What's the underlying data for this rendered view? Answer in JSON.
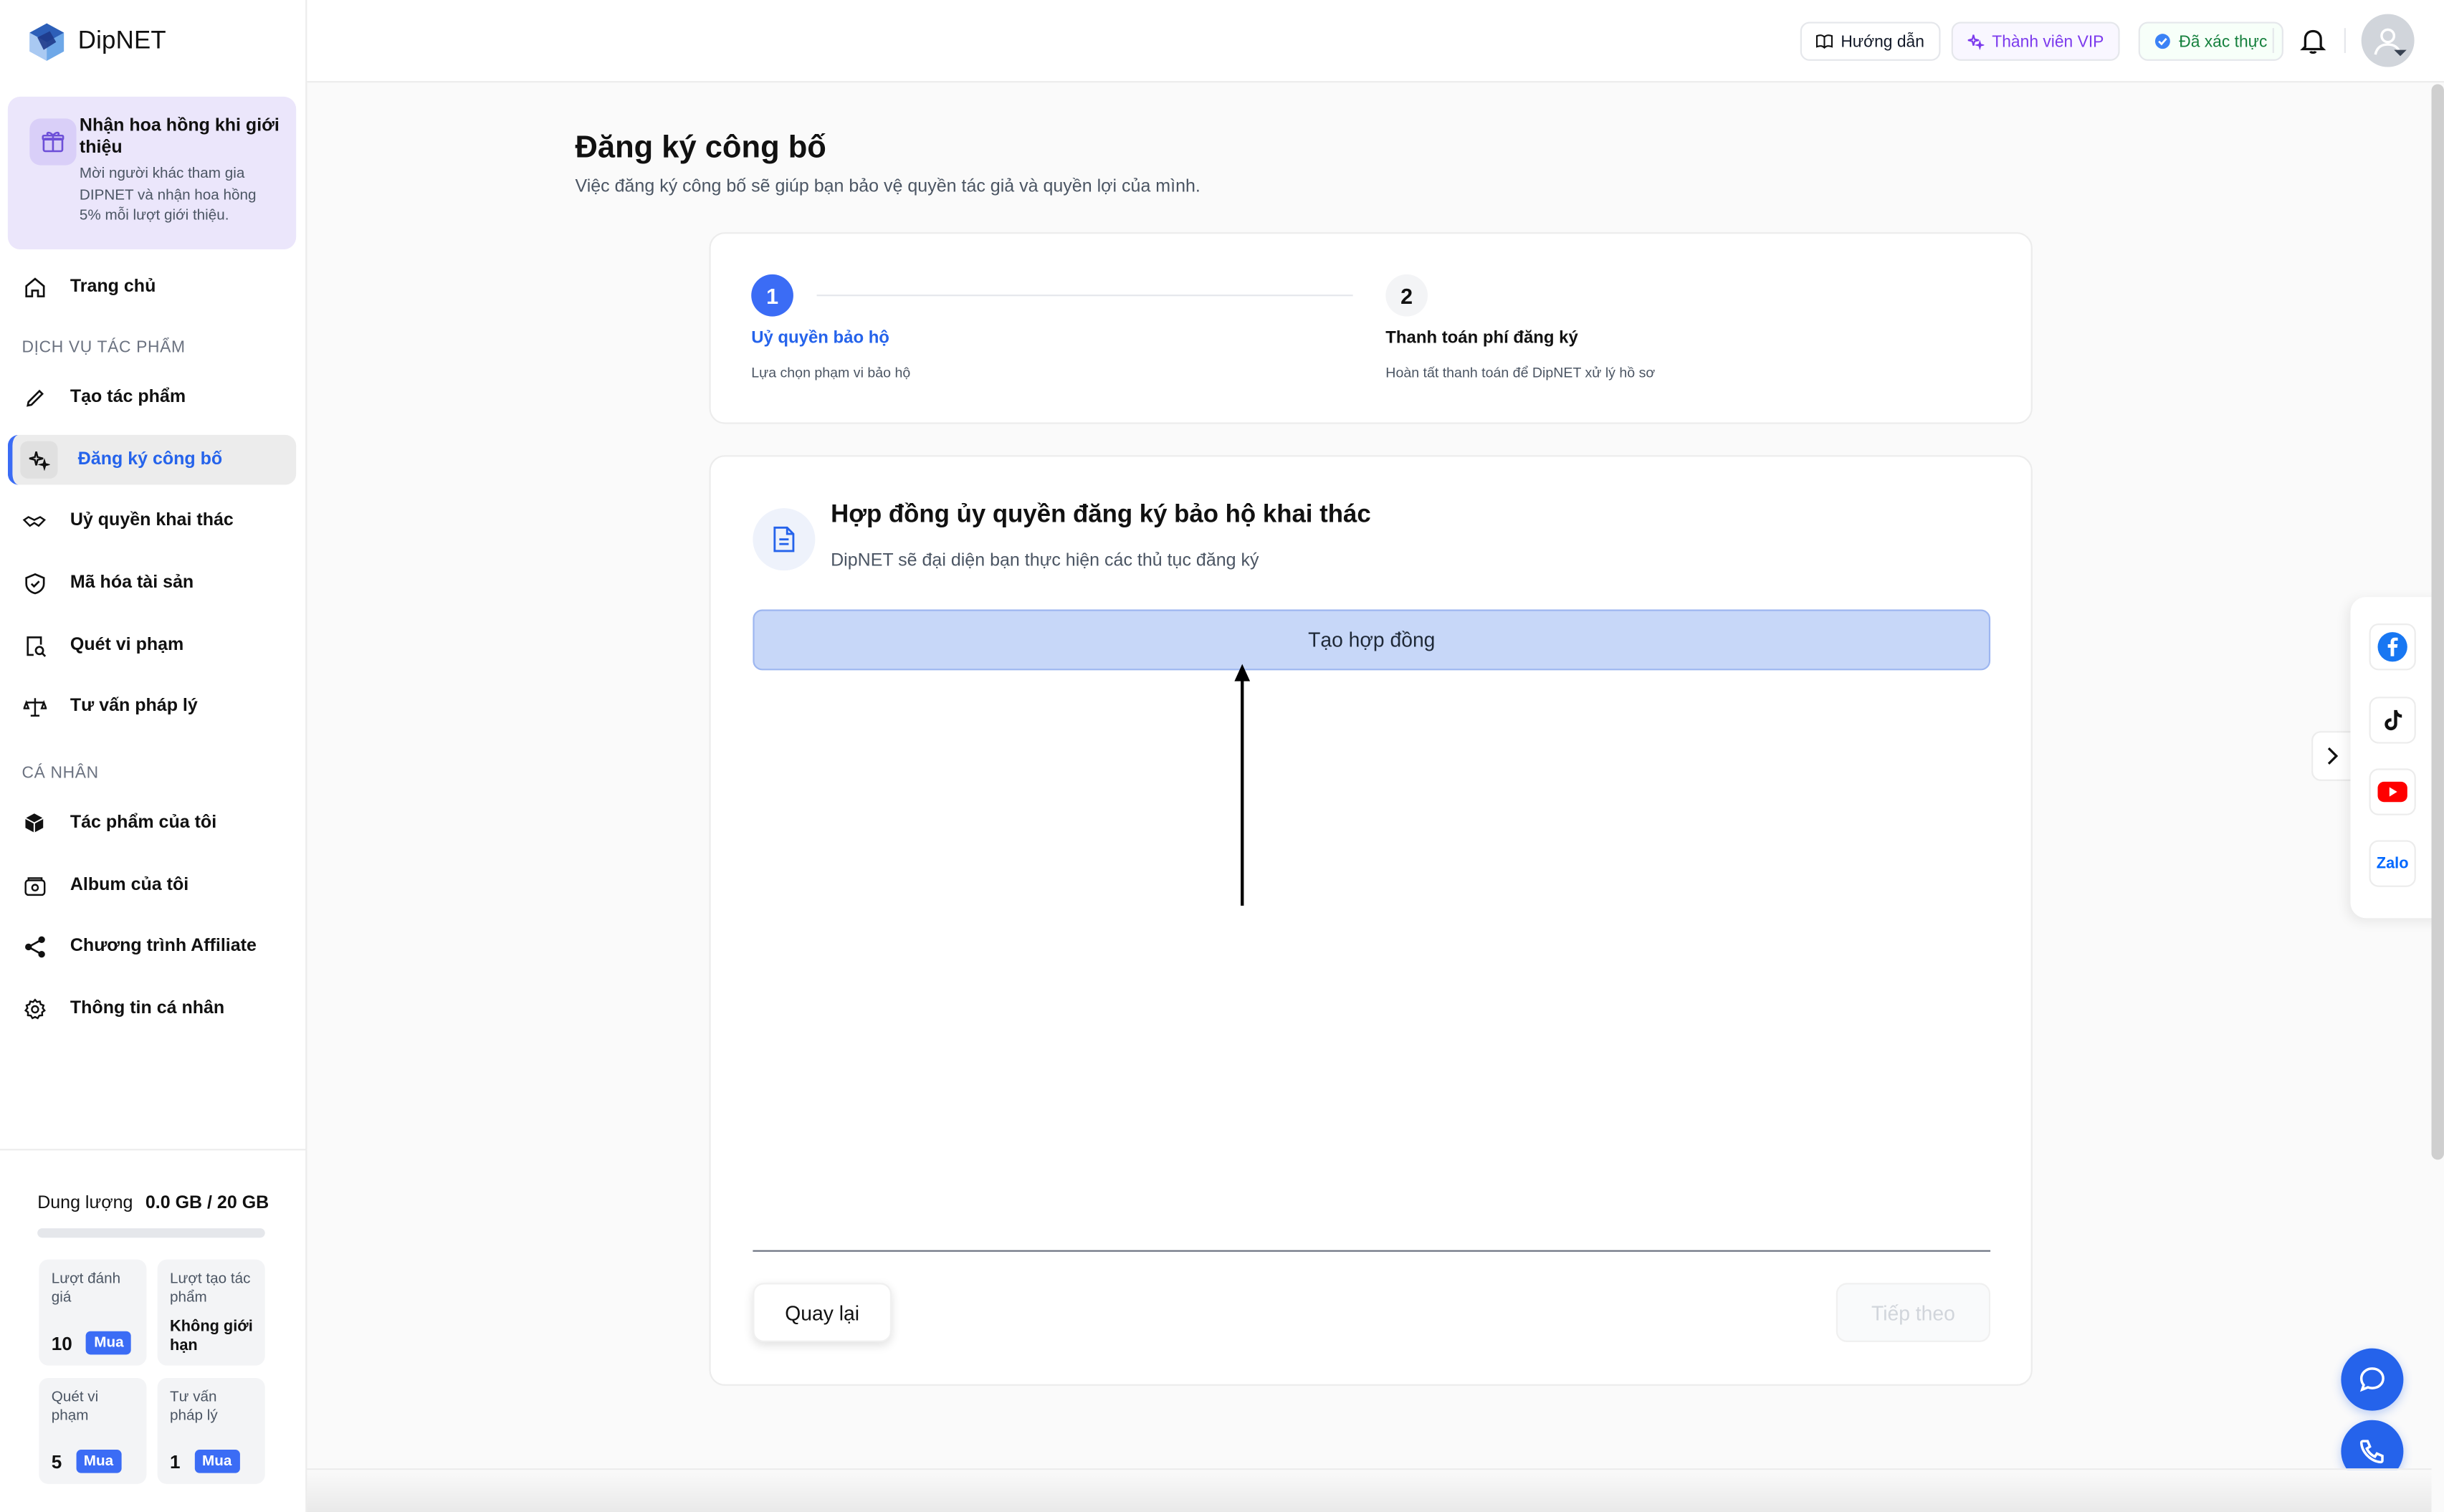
{
  "app": {
    "name": "DipNET"
  },
  "promo": {
    "title": "Nhận hoa hồng khi giới thiệu",
    "description": "Mời người khác tham gia DIPNET và nhận hoa hồng 5% mỗi lượt giới thiệu."
  },
  "sidebar": {
    "home": "Trang chủ",
    "section_works": "DỊCH VỤ TÁC PHẨM",
    "works_items": [
      {
        "label": "Tạo tác phẩm",
        "icon": "pencil-icon"
      },
      {
        "label": "Đăng ký công bố",
        "icon": "sparkle-icon",
        "active": true
      },
      {
        "label": "Uỷ quyền khai thác",
        "icon": "handshake-icon"
      },
      {
        "label": "Mã hóa tài sản",
        "icon": "shield-check-icon"
      },
      {
        "label": "Quét vi phạm",
        "icon": "document-search-icon"
      },
      {
        "label": "Tư vấn pháp lý",
        "icon": "scale-icon"
      }
    ],
    "section_personal": "CÁ NHÂN",
    "personal_items": [
      {
        "label": "Tác phẩm của tôi",
        "icon": "cube-icon"
      },
      {
        "label": "Album của tôi",
        "icon": "album-icon"
      },
      {
        "label": "Chương trình Affiliate",
        "icon": "share-icon"
      },
      {
        "label": "Thông tin cá nhân",
        "icon": "gear-icon"
      }
    ]
  },
  "storage": {
    "label": "Dung lượng",
    "value": "0.0 GB / 20 GB",
    "used_fraction": 0,
    "stats": [
      {
        "label": "Lượt đánh giá",
        "value": "10",
        "buy": "Mua"
      },
      {
        "label": "Lượt tạo tác phẩm",
        "value": "Không giới hạn"
      },
      {
        "label": "Quét vi phạm",
        "value": "5",
        "buy": "Mua"
      },
      {
        "label": "Tư vấn pháp lý",
        "value": "1",
        "buy": "Mua"
      }
    ]
  },
  "header": {
    "guide": "Hướng dẫn",
    "vip": "Thành viên VIP",
    "verified": "Đã xác thực"
  },
  "page": {
    "title": "Đăng ký công bố",
    "subtitle": "Việc đăng ký công bố sẽ giúp bạn bảo vệ quyền tác giả và quyền lợi của mình."
  },
  "steps": [
    {
      "number": "1",
      "title": "Uỷ quyền bảo hộ",
      "description": "Lựa chọn phạm vi bảo hộ",
      "active": true
    },
    {
      "number": "2",
      "title": "Thanh toán phí đăng ký",
      "description": "Hoàn tất thanh toán để DipNET xử lý hồ sơ",
      "active": false
    }
  ],
  "contract": {
    "title": "Hợp đồng ủy quyền đăng ký bảo hộ khai thác",
    "subtitle": "DipNET sẽ đại diện bạn thực hiện các thủ tục đăng ký",
    "create_button": "Tạo hợp đồng"
  },
  "footer_buttons": {
    "back": "Quay lại",
    "next": "Tiếp theo"
  },
  "social": {
    "zalo": "Zalo"
  },
  "colors": {
    "accent": "#3b6cf5",
    "vip": "#7c3aed",
    "verified": "#15803d"
  }
}
